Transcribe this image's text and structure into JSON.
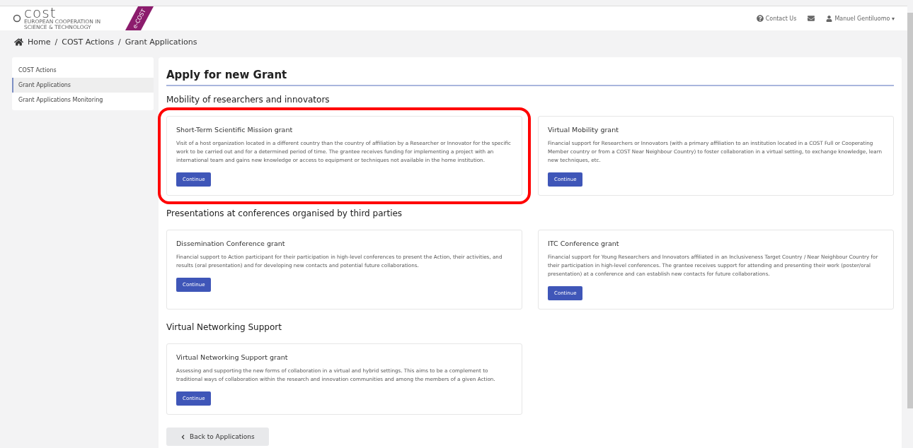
{
  "logo": {
    "name": "cost",
    "tagline": "EUROPEAN COOPERATION IN SCIENCE & TECHNOLOGY",
    "ribbon": "e-COST"
  },
  "header": {
    "contact": "Contact Us",
    "user": "Manuel Gentiluomo",
    "user_caret": "▾"
  },
  "breadcrumb": [
    {
      "label": "Home",
      "separator": "/"
    },
    {
      "label": "COST Actions",
      "separator": "/"
    },
    {
      "label": "Grant Applications"
    }
  ],
  "sidebar": {
    "items": [
      {
        "label": "COST Actions",
        "selected": false
      },
      {
        "label": "Grant Applications",
        "selected": true
      },
      {
        "label": "Grant Applications Monitoring",
        "selected": false
      }
    ]
  },
  "page_title": "Apply for new Grant",
  "sections": [
    {
      "title": "Mobility of researchers and innovators",
      "cards": [
        {
          "title": "Short-Term Scientific Mission grant",
          "text": "Visit of a host organization located in a different country than the country of affiliation by a Researcher or Innovator for the specific work to be carried out and for a determined period of time.  The grantee receives funding for implementing a project with an international team and gains new knowledge or access to equipment or techniques not available in the home institution.",
          "button": "Continue",
          "highlighted": true
        },
        {
          "title": "Virtual Mobility grant",
          "text": "Financial support for Researchers or Innovators (with a primary affiliation to an institution located in a COST Full or Cooperating Member country or from a COST Near Neighbour Country) to foster collaboration in a virtual setting, to exchange knowledge, learn new techniques, etc.",
          "button": "Continue",
          "highlighted": false
        }
      ]
    },
    {
      "title": "Presentations at conferences organised by third parties",
      "cards": [
        {
          "title": "Dissemination Conference grant",
          "text": "Financial support to Action participant for their participation in high-level conferences to present the Action, their activities, and results (oral presentation) and for developing new contacts and potential future collaborations.",
          "button": "Continue",
          "highlighted": false
        },
        {
          "title": "ITC Conference grant",
          "text": "Financial support for Young Researchers and Innovators affiliated in an Inclusiveness Target Country / Near Neighbour Country for their participation in high-level conferences. The grantee receives support for attending and presenting their work (poster/oral presentation) at a conference and can establish new contacts for future collaborations.",
          "button": "Continue",
          "highlighted": false
        }
      ]
    },
    {
      "title": "Virtual Networking Support",
      "cards": [
        {
          "title": "Virtual Networking Support grant",
          "text": "Assessing and supporting the new forms of collaboration in a virtual and hybrid settings. This aims to be a complement to traditional ways of collaboration within the research and innovation communities and among the members of a given Action.",
          "button": "Continue",
          "highlighted": false
        }
      ]
    }
  ],
  "back_button": "Back to Applications"
}
